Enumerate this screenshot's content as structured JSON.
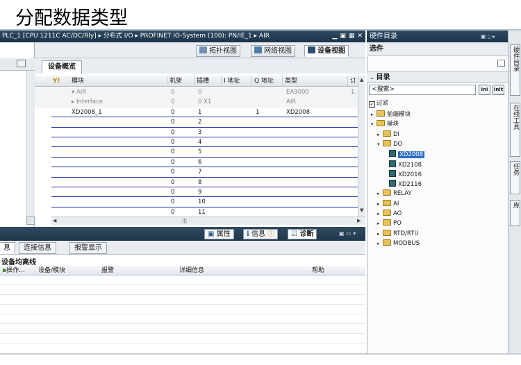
{
  "slide": {
    "title": "分配数据类型"
  },
  "window": {
    "title": "PLC_1 [CPU 1211C AC/DC/Rly] ▸ 分布式 I/O ▸ PROFINET IO-System (100): PN/IE_1 ▸ AIR",
    "controls": [
      "▁",
      "▣",
      "▦",
      "✕"
    ]
  },
  "view_tabs": [
    {
      "label": "拓扑视图",
      "icon": "topology-icon"
    },
    {
      "label": "网络视图",
      "icon": "network-icon"
    },
    {
      "label": "设备视图",
      "icon": "device-icon"
    }
  ],
  "overview_tab": "设备概览",
  "table": {
    "headers": [
      "模块",
      "机架",
      "插槽",
      "I 地址",
      "Q 地址",
      "类型",
      "订"
    ],
    "rows": [
      {
        "module": "▾ AIR",
        "rack": "0",
        "slot": "0",
        "i": "",
        "q": "",
        "type": "EA9000",
        "order": "1.",
        "gray": true
      },
      {
        "module": "▸ Interface",
        "rack": "0",
        "slot": "0 X1",
        "i": "",
        "q": "",
        "type": "AIR",
        "order": "",
        "gray": true
      },
      {
        "module": "XD2008_1",
        "rack": "0",
        "slot": "1",
        "i": "",
        "q": "1",
        "type": "XD2008",
        "order": "",
        "gray": false
      },
      {
        "module": "",
        "rack": "0",
        "slot": "2",
        "i": "",
        "q": "",
        "type": "",
        "order": "",
        "gray": false
      },
      {
        "module": "",
        "rack": "0",
        "slot": "3",
        "i": "",
        "q": "",
        "type": "",
        "order": "",
        "gray": false
      },
      {
        "module": "",
        "rack": "0",
        "slot": "4",
        "i": "",
        "q": "",
        "type": "",
        "order": "",
        "gray": false
      },
      {
        "module": "",
        "rack": "0",
        "slot": "5",
        "i": "",
        "q": "",
        "type": "",
        "order": "",
        "gray": false
      },
      {
        "module": "",
        "rack": "0",
        "slot": "6",
        "i": "",
        "q": "",
        "type": "",
        "order": "",
        "gray": false
      },
      {
        "module": "",
        "rack": "0",
        "slot": "7",
        "i": "",
        "q": "",
        "type": "",
        "order": "",
        "gray": false
      },
      {
        "module": "",
        "rack": "0",
        "slot": "8",
        "i": "",
        "q": "",
        "type": "",
        "order": "",
        "gray": false
      },
      {
        "module": "",
        "rack": "0",
        "slot": "9",
        "i": "",
        "q": "",
        "type": "",
        "order": "",
        "gray": false
      },
      {
        "module": "",
        "rack": "0",
        "slot": "10",
        "i": "",
        "q": "",
        "type": "",
        "order": "",
        "gray": false
      },
      {
        "module": "",
        "rack": "0",
        "slot": "11",
        "i": "",
        "q": "",
        "type": "",
        "order": "",
        "gray": false
      }
    ]
  },
  "inspector_tabs": [
    {
      "label": "属性",
      "icon": "properties-icon"
    },
    {
      "label": "信息",
      "icon": "info-icon"
    },
    {
      "label": "诊断",
      "icon": "diagnostics-icon"
    }
  ],
  "sub_tabs": [
    "息",
    "连接信息",
    "报警显示"
  ],
  "status_text": "设备均离线",
  "log_headers": [
    "操作...",
    "设备/模块",
    "报警",
    "详细信息",
    "帮助"
  ],
  "catalog": {
    "title": "硬件目录",
    "selection_label": "选件",
    "catalog_label": "目录",
    "search_placeholder": "<搜索>",
    "search_btn1": "ini",
    "search_btn2": "init",
    "filter_label": "过滤",
    "tree": [
      {
        "label": "前端模块",
        "level": 0,
        "type": "folder",
        "open": false
      },
      {
        "label": "模块",
        "level": 0,
        "type": "folder",
        "open": true
      },
      {
        "label": "DI",
        "level": 1,
        "type": "folder",
        "open": false
      },
      {
        "label": "DO",
        "level": 1,
        "type": "folder",
        "open": true
      },
      {
        "label": "XD2008",
        "level": 2,
        "type": "module",
        "selected": true
      },
      {
        "label": "XD2108",
        "level": 2,
        "type": "module"
      },
      {
        "label": "XD2016",
        "level": 2,
        "type": "module"
      },
      {
        "label": "XD2116",
        "level": 2,
        "type": "module"
      },
      {
        "label": "RELAY",
        "level": 1,
        "type": "folder",
        "open": false
      },
      {
        "label": "AI",
        "level": 1,
        "type": "folder",
        "open": false
      },
      {
        "label": "AO",
        "level": 1,
        "type": "folder",
        "open": false
      },
      {
        "label": "PO",
        "level": 1,
        "type": "folder",
        "open": false
      },
      {
        "label": "RTD/RTU",
        "level": 1,
        "type": "folder",
        "open": false
      },
      {
        "label": "MODBUS",
        "level": 1,
        "type": "folder",
        "open": false
      }
    ]
  },
  "side_rail": [
    "硬件目录",
    "在线工具",
    "任务",
    "库"
  ]
}
